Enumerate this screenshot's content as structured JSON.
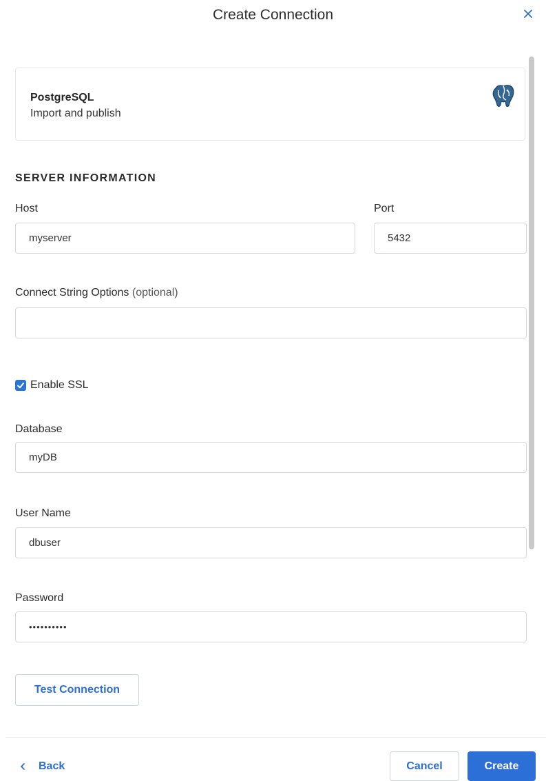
{
  "dialog": {
    "title": "Create Connection"
  },
  "connector": {
    "name": "PostgreSQL",
    "description": "Import and publish",
    "icon": "postgresql-elephant-icon"
  },
  "server_info": {
    "heading": "SERVER INFORMATION",
    "host": {
      "label": "Host",
      "value": "myserver"
    },
    "port": {
      "label": "Port",
      "value": "5432"
    },
    "connect_string": {
      "label": "Connect String Options",
      "optional": "(optional)",
      "value": ""
    },
    "ssl": {
      "label": "Enable SSL",
      "checked": true
    },
    "database": {
      "label": "Database",
      "value": "myDB"
    },
    "username": {
      "label": "User Name",
      "value": "dbuser"
    },
    "password": {
      "label": "Password",
      "value": "••••••••••"
    },
    "test_button": "Test Connection"
  },
  "footer": {
    "back_label": "Back",
    "cancel_label": "Cancel",
    "create_label": "Create"
  },
  "colors": {
    "accent": "#2c6fd6",
    "border": "#d4d7dd",
    "text": "#2b2b2b"
  }
}
